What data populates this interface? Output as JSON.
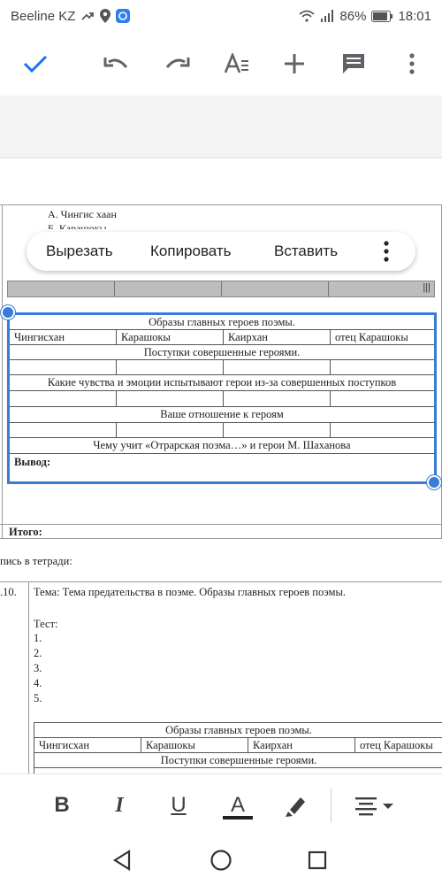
{
  "status_bar": {
    "carrier": "Beeline KZ",
    "battery": "86%",
    "time": "18:01"
  },
  "toolbar": {
    "icons": [
      "check-icon",
      "undo-icon",
      "redo-icon",
      "text-format-icon",
      "add-icon",
      "comment-icon",
      "more-vert-icon"
    ],
    "accent": "#1a73e8"
  },
  "document": {
    "option_a": "А. Чингис хаан",
    "option_b": "Б. Карашокы",
    "context_menu": {
      "cut": "Вырезать",
      "copy": "Копировать",
      "paste": "Вставить"
    },
    "table": {
      "title": "Образы главных героев поэмы.",
      "columns": [
        "Чингисхан",
        "Карашокы",
        "Каирхан",
        "отец Карашокы"
      ],
      "row_deeds": "Поступки совершенные  героями.",
      "row_feelings": "Какие чувства  и эмоции испытывают герои из-за совершенных поступков",
      "row_attitude": "Ваше отношение к героям",
      "row_teaches": "Чему учит «Отрарская  поэма…»  и герои М. Шаханова",
      "conclusion": "Вывод:"
    },
    "total": "Итого:",
    "notebook": "пись в тетради:",
    "lesson_number": ".10.",
    "topic": "Тема: Тема предательства в поэме.  Образы главных героев поэмы.",
    "test_label": "Тест:",
    "test_items": [
      "1.",
      "2.",
      "3.",
      "4.",
      "5."
    ],
    "table2": {
      "title": "Образы главных героев поэмы.",
      "columns": [
        "Чингисхан",
        "Карашокы",
        "Каирхан",
        "отец Карашокы"
      ],
      "row_deeds": "Поступки совершенные  героями."
    }
  },
  "format_toolbar": {
    "icons": [
      "bold-icon",
      "italic-icon",
      "underline-icon",
      "text-color-icon",
      "highlight-icon",
      "align-icon"
    ],
    "bold": "B",
    "italic": "I",
    "underline": "U",
    "text_color": "A"
  },
  "nav_bar": {
    "icons": [
      "back-icon",
      "home-icon",
      "recents-icon"
    ]
  }
}
